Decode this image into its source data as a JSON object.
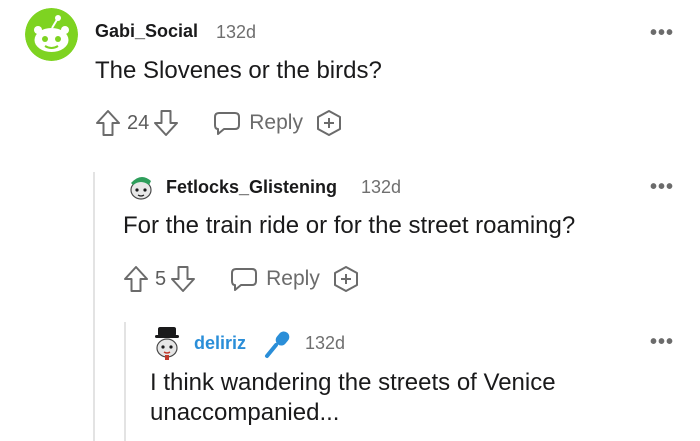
{
  "comments": [
    {
      "username": "Gabi_Social",
      "age": "132d",
      "text": "The Slovenes or the birds?",
      "votes": "24",
      "reply_label": "Reply",
      "more_label": "•••"
    },
    {
      "username": "Fetlocks_Glistening",
      "age": "132d",
      "text": "For the train ride or for the street roaming?",
      "votes": "5",
      "reply_label": "Reply",
      "more_label": "•••"
    },
    {
      "username": "deliriz",
      "username_color": "#2a8ed8",
      "age": "132d",
      "text": "I think wandering the streets of Venice unaccompanied...",
      "more_label": "•••"
    }
  ],
  "colors": {
    "gabi_avatar": "#7ed321",
    "text": "#1a1a1b",
    "muted": "#6b6b6b",
    "thread_line": "#e3e3e3",
    "mic_badge": "#2a8ed8"
  },
  "icons": [
    "upvote-icon",
    "downvote-icon",
    "reply-bubble-icon",
    "award-plus-icon",
    "microphone-icon",
    "more-options-icon"
  ]
}
